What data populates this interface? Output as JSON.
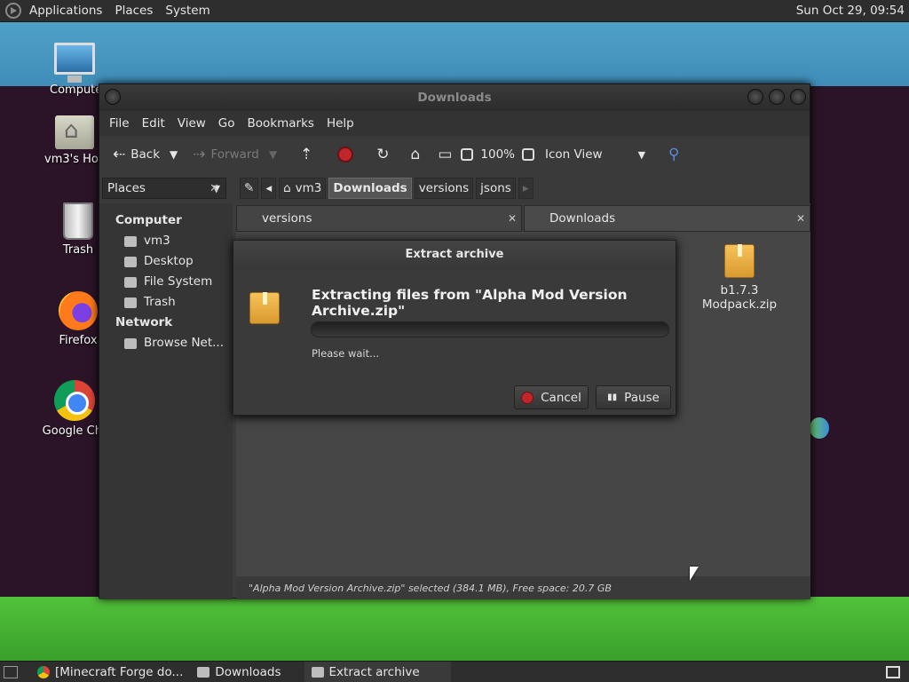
{
  "top_panel": {
    "menus": [
      "Applications",
      "Places",
      "System"
    ],
    "clock": "Sun Oct 29, 09:54"
  },
  "desktop_icons": [
    {
      "label": "Compute",
      "icon": "computer-icon"
    },
    {
      "label": "vm3's Hor",
      "icon": "home-folder-icon"
    },
    {
      "label": "Trash",
      "icon": "trash-icon"
    },
    {
      "label": "Firefox",
      "icon": "firefox-icon"
    },
    {
      "label": "Google Chr",
      "icon": "chrome-icon"
    }
  ],
  "window": {
    "title": "Downloads",
    "menu": [
      "File",
      "Edit",
      "View",
      "Go",
      "Bookmarks",
      "Help"
    ],
    "toolbar": {
      "back": "Back",
      "forward": "Forward",
      "zoom": "100%",
      "view_mode": "Icon View"
    },
    "places_combo": "Places",
    "breadcrumbs": [
      "vm3",
      "Downloads",
      "versions",
      "jsons"
    ],
    "active_crumb": "Downloads",
    "sidebar": {
      "computer_heading": "Computer",
      "computer_items": [
        "vm3",
        "Desktop",
        "File System",
        "Trash"
      ],
      "network_heading": "Network",
      "network_items": [
        "Browse Net..."
      ]
    },
    "tabs": [
      {
        "label": "versions"
      },
      {
        "label": "Downloads"
      }
    ],
    "files": [
      {
        "name": "b1.7.3 Modpack.zip",
        "icon": "package-icon"
      }
    ],
    "status": "\"Alpha Mod Version Archive.zip\" selected (384.1 MB), Free space: 20.7 GB"
  },
  "dialog": {
    "title": "Extract archive",
    "heading": "Extracting files from \"Alpha Mod Version Archive.zip\"",
    "progress_fraction": 0,
    "status": "Please wait...",
    "cancel_label": "Cancel",
    "pause_label": "Pause"
  },
  "taskbar": {
    "tasks": [
      {
        "label": "[Minecraft Forge do...",
        "icon": "chrome-icon"
      },
      {
        "label": "Downloads",
        "icon": "folder-icon"
      },
      {
        "label": "Extract archive",
        "icon": "archive-icon"
      }
    ]
  }
}
